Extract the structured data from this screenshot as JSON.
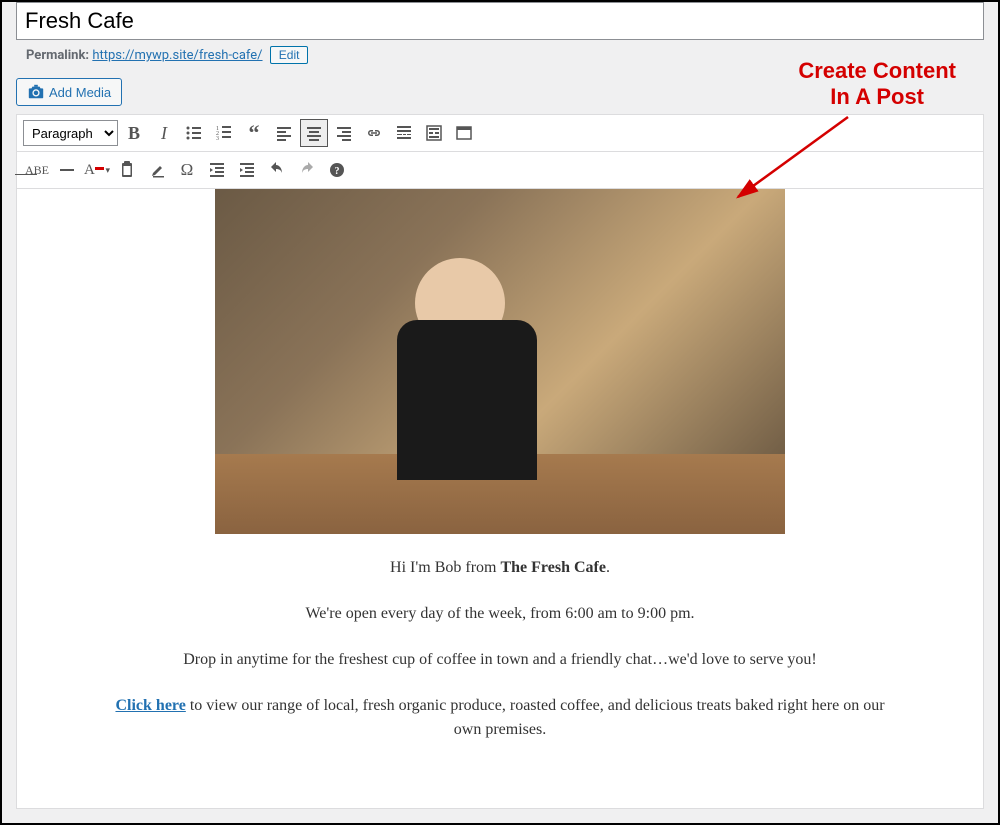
{
  "title": "Fresh Cafe",
  "permalink": {
    "label": "Permalink:",
    "url": "https://mywp.site/fresh-cafe/",
    "edit_label": "Edit"
  },
  "add_media_label": "Add Media",
  "format_dropdown": "Paragraph",
  "content": {
    "p1_prefix": "Hi I'm Bob from ",
    "p1_bold": "The Fresh Cafe",
    "p1_suffix": ".",
    "p2": "We're open every day of the week, from 6:00 am to 9:00 pm.",
    "p3": "Drop in anytime for the freshest cup of coffee in town and a friendly chat…we'd love to serve you!",
    "p4_link": "Click here",
    "p4_rest": " to view our range of local, fresh organic produce, roasted coffee, and delicious treats baked right here on our own premises."
  },
  "annotation": {
    "line1": "Create Content",
    "line2": "In A Post"
  },
  "toolbar_row1": [
    {
      "name": "bold-button",
      "label": "B"
    },
    {
      "name": "italic-button",
      "label": "I"
    },
    {
      "name": "bullet-list-button"
    },
    {
      "name": "numbered-list-button"
    },
    {
      "name": "blockquote-button"
    },
    {
      "name": "align-left-button"
    },
    {
      "name": "align-center-button",
      "active": true
    },
    {
      "name": "align-right-button"
    },
    {
      "name": "link-button"
    },
    {
      "name": "insert-more-button"
    },
    {
      "name": "toolbar-toggle-button"
    },
    {
      "name": "fullscreen-button"
    }
  ],
  "toolbar_row2": [
    {
      "name": "strikethrough-button"
    },
    {
      "name": "horizontal-rule-button"
    },
    {
      "name": "text-color-button"
    },
    {
      "name": "paste-text-button"
    },
    {
      "name": "clear-formatting-button"
    },
    {
      "name": "special-char-button"
    },
    {
      "name": "outdent-button"
    },
    {
      "name": "indent-button"
    },
    {
      "name": "undo-button"
    },
    {
      "name": "redo-button",
      "disabled": true
    },
    {
      "name": "help-button"
    }
  ]
}
